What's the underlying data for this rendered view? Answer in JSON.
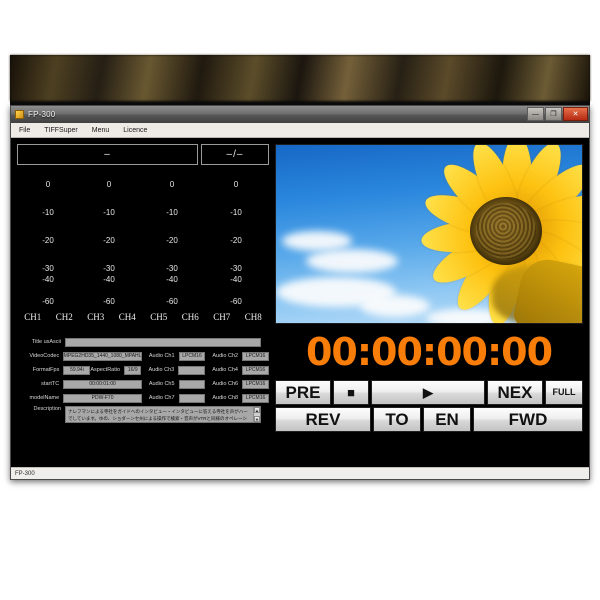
{
  "window": {
    "title": "FP-300",
    "controls": {
      "minimize": "—",
      "maximize": "❐",
      "close": "✕"
    }
  },
  "menubar": {
    "items": [
      {
        "label": "File"
      },
      {
        "label": "TIFFSuper"
      },
      {
        "label": "Menu"
      },
      {
        "label": "Licence"
      }
    ]
  },
  "audio_meters": {
    "readout_level": "–",
    "readout_ratio": "–/–",
    "scale_labels": [
      "0",
      "-10",
      "-20",
      "-30",
      "-40",
      "-60"
    ],
    "channels": [
      "CH1",
      "CH2",
      "CH3",
      "CH4",
      "CH5",
      "CH6",
      "CH7",
      "CH8"
    ]
  },
  "timecode": {
    "value": "00:00:00:00",
    "color": "#f97d09"
  },
  "transport": {
    "row1": [
      {
        "label": "PRE",
        "name": "prev-button"
      },
      {
        "label": "■",
        "name": "stop-button"
      },
      {
        "label": "▶",
        "name": "play-button"
      },
      {
        "label": "NEX",
        "name": "next-button"
      },
      {
        "label": "FULL",
        "name": "fullscreen-button"
      }
    ],
    "row2": [
      {
        "label": "REV",
        "name": "rewind-button"
      },
      {
        "label": "TO",
        "name": "top-button"
      },
      {
        "label": "EN",
        "name": "end-button"
      },
      {
        "label": "FWD",
        "name": "forward-button"
      }
    ]
  },
  "metadata": {
    "title_usascii": {
      "label": "Title usAscii",
      "value": ""
    },
    "video_codec": {
      "label": "VideoCodec",
      "value": "MPEG2HD35_1440_1080_MPAHL"
    },
    "format_fps": {
      "label": "FormatFps",
      "value": "59.94i"
    },
    "aspect_ratio": {
      "label": "AspectRatio",
      "value": "16/9"
    },
    "start_tc": {
      "label": "startTC",
      "value": "00:00:01:00"
    },
    "model_name": {
      "label": "modelName",
      "value": "PDW-F70"
    },
    "audio_channels": [
      {
        "label": "Audio Ch1",
        "value": "LPCM16"
      },
      {
        "label": "Audio Ch2",
        "value": "LPCM16"
      },
      {
        "label": "Audio Ch3",
        "value": ""
      },
      {
        "label": "Audio Ch4",
        "value": "LPCM16"
      },
      {
        "label": "Audio Ch5",
        "value": ""
      },
      {
        "label": "Audio Ch6",
        "value": "LPCM16"
      },
      {
        "label": "Audio Ch7",
        "value": ""
      },
      {
        "label": "Audio Ch8",
        "value": "LPCM16"
      }
    ],
    "description": {
      "label": "Description",
      "value": "ナレフマンによる寺社をガイドへのインタビュー・インタビューに答える寺社を声がハーでしています。ゆの、ショダーンセ州による操作で検索・音声がVTRと同様のオペレーションが実現でき"
    }
  },
  "statusbar": {
    "text": "FP-300"
  }
}
